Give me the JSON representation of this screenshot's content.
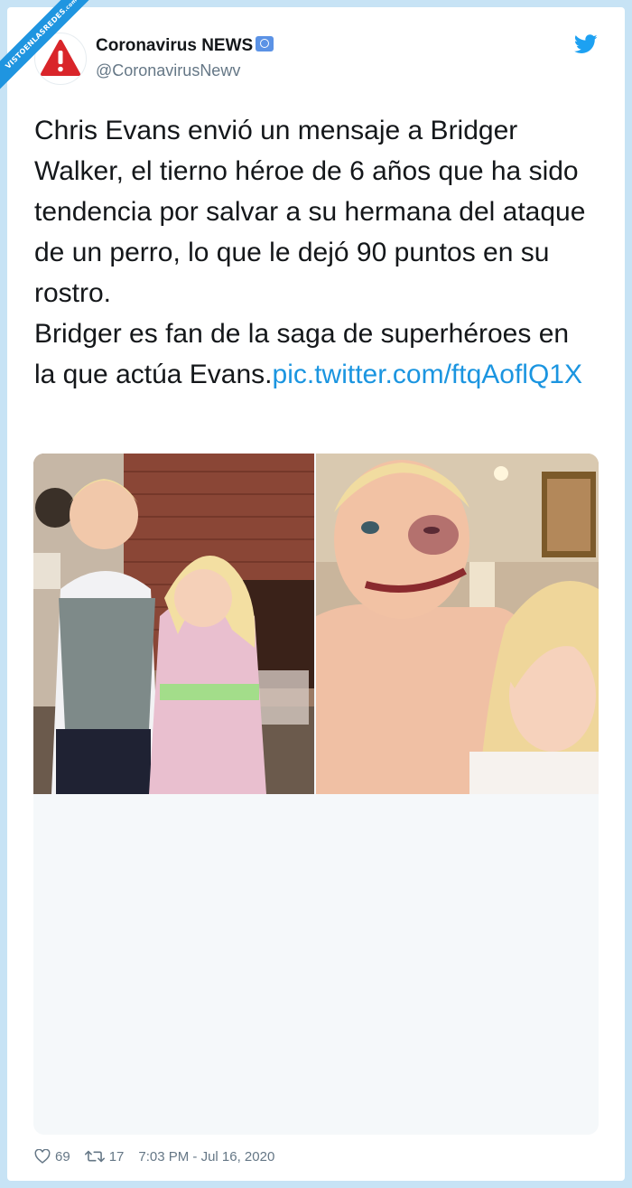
{
  "watermark": {
    "text": "VISTOENLASREDES",
    "suffix": ".com"
  },
  "tweet": {
    "author_name": "Coronavirus NEWS",
    "author_handle": "@CoronavirusNewv",
    "text_main": "Chris Evans envió un mensaje a Bridger Walker, el tierno héroe de 6 años que ha sido tendencia por salvar a su hermana del ataque de un perro, lo que le dejó 90 puntos en su rostro.",
    "text_second": "Bridger es fan de la saga de superhéroes en la que actúa Evans.",
    "link": "pic.twitter.com/ftqAoflQ1X",
    "likes": "69",
    "retweets": "17",
    "timestamp": "7:03 PM - Jul 16, 2020"
  },
  "icons": {
    "avatar": "warning-icon",
    "verified": "un-badge-icon",
    "brand": "twitter-bird-icon",
    "like": "heart-icon",
    "retweet": "retweet-icon"
  },
  "colors": {
    "link": "#1b95e0",
    "text": "#14171a",
    "muted": "#657786",
    "avatar_red": "#d9252a",
    "background": "#c7e3f5"
  }
}
